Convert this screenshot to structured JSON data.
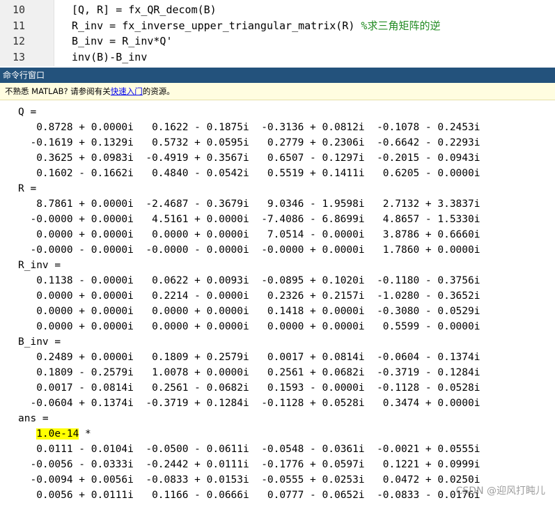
{
  "editor": {
    "lines": [
      {
        "num": "10",
        "code": "[Q, R] = fx_QR_decom(B)",
        "comment": ""
      },
      {
        "num": "11",
        "code": "R_inv = fx_inverse_upper_triangular_matrix(R) ",
        "comment": "%求三角矩阵的逆"
      },
      {
        "num": "12",
        "code": "B_inv = R_inv*Q'",
        "comment": ""
      },
      {
        "num": "13",
        "code": "inv(B)-B_inv",
        "comment": ""
      }
    ]
  },
  "panel": {
    "title": "命令行窗口"
  },
  "notice": {
    "before": "不熟悉 MATLAB? 请参阅有关",
    "link": "快速入门",
    "after": "的资源。"
  },
  "console": {
    "lines": [
      {
        "text": "Q =",
        "indent": 0
      },
      {
        "text": "0.8728 + 0.0000i   0.1622 - 0.1875i  -0.3136 + 0.0812i  -0.1078 - 0.2453i",
        "indent": 2
      },
      {
        "text": "-0.1619 + 0.1329i   0.5732 + 0.0595i   0.2779 + 0.2306i  -0.6642 - 0.2293i",
        "indent": 1
      },
      {
        "text": "0.3625 + 0.0983i  -0.4919 + 0.3567i   0.6507 - 0.1297i  -0.2015 - 0.0943i",
        "indent": 2
      },
      {
        "text": "0.1602 - 0.1662i   0.4840 - 0.0542i   0.5519 + 0.1411i   0.6205 - 0.0000i",
        "indent": 2
      },
      {
        "text": "R =",
        "indent": 0
      },
      {
        "text": "8.7861 + 0.0000i  -2.4687 - 0.3679i   9.0346 - 1.9598i   2.7132 + 3.3837i",
        "indent": 2
      },
      {
        "text": "-0.0000 + 0.0000i   4.5161 + 0.0000i  -7.4086 - 6.8699i   4.8657 - 1.5330i",
        "indent": 1
      },
      {
        "text": "0.0000 + 0.0000i   0.0000 + 0.0000i   7.0514 - 0.0000i   3.8786 + 0.6660i",
        "indent": 2
      },
      {
        "text": "-0.0000 - 0.0000i  -0.0000 - 0.0000i  -0.0000 + 0.0000i   1.7860 + 0.0000i",
        "indent": 1
      },
      {
        "text": "R_inv =",
        "indent": 0
      },
      {
        "text": "0.1138 - 0.0000i   0.0622 + 0.0093i  -0.0895 + 0.1020i  -0.1180 - 0.3756i",
        "indent": 2
      },
      {
        "text": "0.0000 + 0.0000i   0.2214 - 0.0000i   0.2326 + 0.2157i  -1.0280 - 0.3652i",
        "indent": 2
      },
      {
        "text": "0.0000 + 0.0000i   0.0000 + 0.0000i   0.1418 + 0.0000i  -0.3080 - 0.0529i",
        "indent": 2
      },
      {
        "text": "0.0000 + 0.0000i   0.0000 + 0.0000i   0.0000 + 0.0000i   0.5599 - 0.0000i",
        "indent": 2
      },
      {
        "text": "B_inv =",
        "indent": 0
      },
      {
        "text": "0.2489 + 0.0000i   0.1809 + 0.2579i   0.0017 + 0.0814i  -0.0604 - 0.1374i",
        "indent": 2
      },
      {
        "text": "0.1809 - 0.2579i   1.0078 + 0.0000i   0.2561 + 0.0682i  -0.3719 - 0.1284i",
        "indent": 2
      },
      {
        "text": "0.0017 - 0.0814i   0.2561 - 0.0682i   0.1593 - 0.0000i  -0.1128 - 0.0528i",
        "indent": 2
      },
      {
        "text": "-0.0604 + 0.1374i  -0.3719 + 0.1284i  -0.1128 + 0.0528i   0.3474 + 0.0000i",
        "indent": 1
      },
      {
        "text": "ans =",
        "indent": 0
      },
      {
        "text": "1.0e-14",
        "indent": 2,
        "highlight": true,
        "suffix": " *"
      },
      {
        "text": "0.0111 - 0.0104i  -0.0500 - 0.0611i  -0.0548 - 0.0361i  -0.0021 + 0.0555i",
        "indent": 2
      },
      {
        "text": "-0.0056 - 0.0333i  -0.2442 + 0.0111i  -0.1776 + 0.0597i   0.1221 + 0.0999i",
        "indent": 1
      },
      {
        "text": "-0.0094 + 0.0056i  -0.0833 + 0.0153i  -0.0555 + 0.0253i   0.0472 + 0.0250i",
        "indent": 1
      },
      {
        "text": "0.0056 + 0.0111i   0.1166 - 0.0666i   0.0777 - 0.0652i  -0.0833 - 0.0176i",
        "indent": 2
      }
    ]
  },
  "watermark": {
    "text": "CSDN @迎风打盹儿"
  }
}
